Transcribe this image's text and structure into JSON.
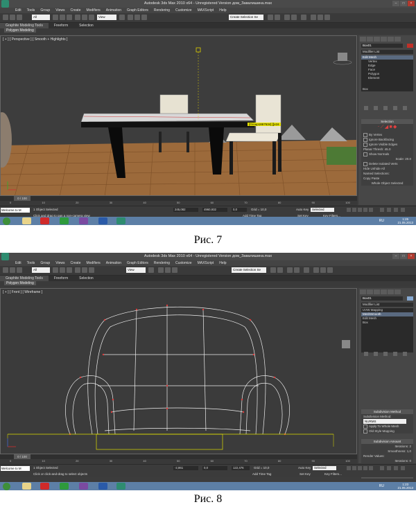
{
  "figures": [
    {
      "caption": "Рис. 7",
      "window_title": "Autodesk 3ds Max 2010 x64 - Unregistered Version   дом_Завалишина.max",
      "menu": [
        "Edit",
        "Tools",
        "Group",
        "Views",
        "Create",
        "Modifiers",
        "Animation",
        "Graph Editors",
        "Rendering",
        "Customize",
        "MAXScript",
        "Help"
      ],
      "toolbar": {
        "filter": "All",
        "view": "View",
        "selection_set": "Create Selection Se"
      },
      "ribbon_tabs": [
        "Graphite Modeling Tools",
        "Freeform",
        "Selection"
      ],
      "ribbon_sub": "Polygon Modeling",
      "viewport_label": "[ + ] [ Perspective ] [ Smooth + Highlights ]",
      "viewport_tooltip": "[Group1867634] [[x16",
      "object_name": "Box01",
      "modifier_list": "Modifier List",
      "stack": [
        "Edit Mesh",
        "Vertex",
        "Edge",
        "Face",
        "Polygon",
        "Element",
        "Box"
      ],
      "rollout_title": "Selection",
      "rollout_rows": [
        "By Vertex",
        "Ignore Backfacing",
        "Ignore Visible Edges",
        "Planar Thresh: 45.0",
        "Show Normals",
        "Scale: 20.0",
        "Delete Isolated Verts",
        "Hide     Unhide All",
        "Named Selections:",
        "Copy     Paste",
        "Whole Object Selected"
      ],
      "time_slider": "0 / 100",
      "ticks": [
        "0",
        "10",
        "20",
        "30",
        "40",
        "50",
        "60",
        "70",
        "80",
        "90",
        "100"
      ],
      "status1": "1 Object Selected",
      "status2": "Click and drag to pan a non-camera view",
      "welcome": "Welcome to M",
      "coords": {
        "x": "245,082",
        "y": "4960,932",
        "z": "0,0"
      },
      "grid": "Grid = 10,0",
      "add_time_tag": "Add Time Tag",
      "auto_key": "Auto Key",
      "selected": "Selected",
      "set_key": "Set Key",
      "key_filters": "Key Filters...",
      "lang": "RU",
      "clock": {
        "time": "1:25",
        "date": "21.05.2013"
      }
    },
    {
      "caption": "Рис. 8",
      "window_title": "Autodesk 3ds Max 2010 x64 - Unregistered Version   дом_Завалишина.max",
      "menu": [
        "Edit",
        "Tools",
        "Group",
        "Views",
        "Create",
        "Modifiers",
        "Animation",
        "Graph Editors",
        "Rendering",
        "Customize",
        "MAXScript",
        "Help"
      ],
      "toolbar": {
        "filter": "All",
        "view": "View",
        "selection_set": "Create Selection Se"
      },
      "ribbon_tabs": [
        "Graphite Modeling Tools",
        "Freeform",
        "Selection"
      ],
      "ribbon_sub": "Polygon Modeling",
      "viewport_label": "[ + ] [ Front ] [ Wireframe ]",
      "object_name": "Box01",
      "modifier_list": "Modifier List",
      "stack": [
        "UVW Mapping",
        "MeshSmooth",
        "Edit Mesh",
        "Box"
      ],
      "rollout_title": "Subdivision Method",
      "rollout_rows": [
        "Subdivision Method:",
        "NURMS",
        "Apply To Whole Mesh",
        "Old Style Mapping"
      ],
      "rollout2_title": "Subdivision Amount",
      "rollout2_rows": [
        "Iterations: 2",
        "Smoothness: 1,0",
        "Render Values:",
        "Iterations: 0",
        "Smoothness: 1,0"
      ],
      "rollout3_title": "Local Control",
      "time_slider": "0 / 100",
      "ticks": [
        "0",
        "10",
        "20",
        "30",
        "40",
        "50",
        "60",
        "70",
        "80",
        "90",
        "100"
      ],
      "status1": "1 Object Selected",
      "status2": "Click or click-and-drag to select objects",
      "welcome": "Welcome to M",
      "coords": {
        "x": "-2,861",
        "y": "0,0",
        "z": "122,476"
      },
      "grid": "Grid = 10,0",
      "add_time_tag": "Add Time Tag",
      "auto_key": "Auto Key",
      "selected": "Selected",
      "set_key": "Set Key",
      "key_filters": "Key Filters...",
      "lang": "RU",
      "clock": {
        "time": "1:23",
        "date": "21.05.2013"
      }
    }
  ]
}
